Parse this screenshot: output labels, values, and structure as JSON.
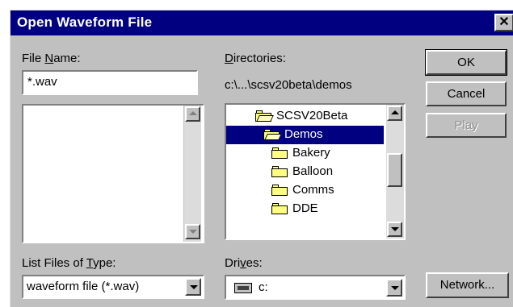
{
  "window": {
    "title": "Open Waveform File",
    "close_glyph": "✕"
  },
  "file_name": {
    "label_pre": "File ",
    "label_accel": "N",
    "label_post": "ame:",
    "value": "*.wav",
    "files": []
  },
  "directories": {
    "label_pre": "",
    "label_accel": "D",
    "label_post": "irectories:",
    "path": "c:\\...\\scsv20beta\\demos",
    "items": [
      {
        "label": "SCSV20Beta",
        "icon": "open-folder-icon",
        "selected": false
      },
      {
        "label": "Demos",
        "icon": "open-folder-icon",
        "selected": true
      },
      {
        "label": "Bakery",
        "icon": "folder-icon",
        "selected": false
      },
      {
        "label": "Balloon",
        "icon": "folder-icon",
        "selected": false
      },
      {
        "label": "Comms",
        "icon": "folder-icon",
        "selected": false
      },
      {
        "label": "DDE",
        "icon": "folder-icon",
        "selected": false
      }
    ]
  },
  "file_type": {
    "label_pre": "List Files of ",
    "label_accel": "T",
    "label_post": "ype:",
    "value": "waveform file (*.wav)"
  },
  "drives": {
    "label_pre": "Dri",
    "label_accel": "v",
    "label_post": "es:",
    "value": "c:",
    "icon": "hard-drive-icon"
  },
  "buttons": {
    "ok": "OK",
    "cancel": "Cancel",
    "play": "Play",
    "network": "Network..."
  },
  "colors": {
    "titlebar": "#000080",
    "face": "#c0c0c0",
    "selection": "#000080",
    "folder": "#ffff80"
  }
}
